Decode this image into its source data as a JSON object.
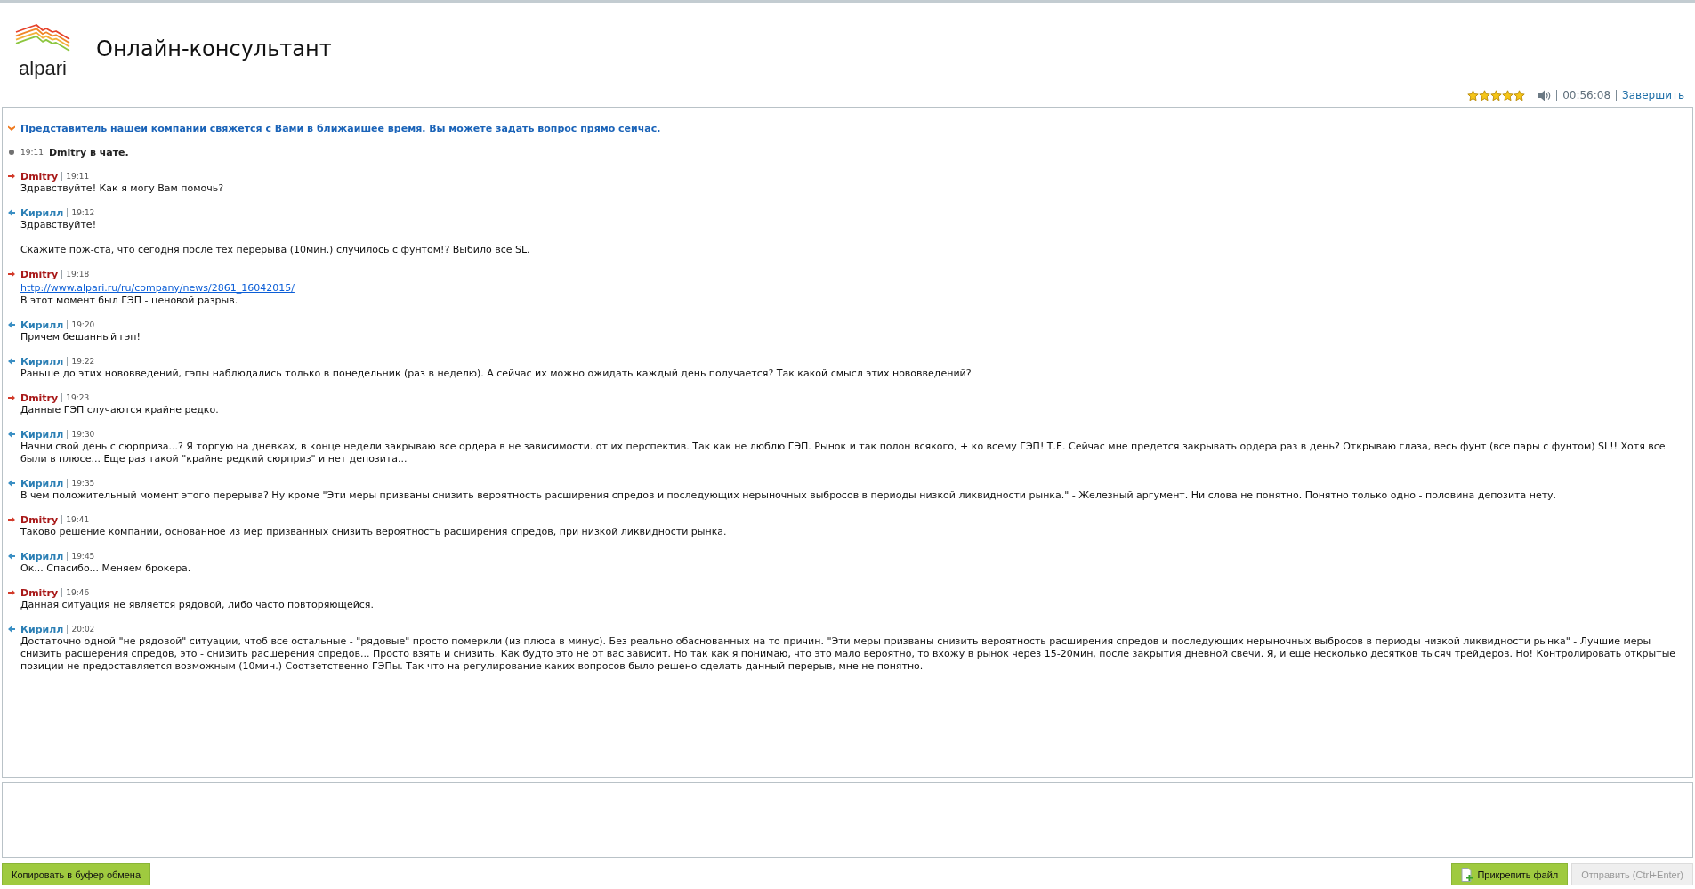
{
  "header": {
    "logo_text": "alpari",
    "title": "Онлайн-консультант"
  },
  "status": {
    "stars": 5,
    "timer": "00:56:08",
    "end_link": "Завершить"
  },
  "chat": {
    "items": [
      {
        "kind": "notice",
        "text": "Представитель нашей компании свяжется с Вами в ближайшее время. Вы можете задать вопрос прямо сейчас."
      },
      {
        "kind": "system",
        "time": "19:11",
        "text": "Dmitry в чате."
      },
      {
        "kind": "agent",
        "author": "Dmitry",
        "time": "19:11",
        "paragraphs": [
          {
            "lines": [
              {
                "kind": "text",
                "text": "Здравствуйте! Как я могу Вам помочь?"
              }
            ]
          }
        ]
      },
      {
        "kind": "client",
        "author": "Кирилл",
        "time": "19:12",
        "paragraphs": [
          {
            "lines": [
              {
                "kind": "text",
                "text": "Здравствуйте!"
              }
            ]
          },
          {
            "lines": [
              {
                "kind": "text",
                "text": "Скажите пож-ста, что сегодня после тех перерыва (10мин.) случилось с фунтом!? Выбило все SL."
              }
            ]
          }
        ]
      },
      {
        "kind": "agent",
        "author": "Dmitry",
        "time": "19:18",
        "paragraphs": [
          {
            "lines": [
              {
                "kind": "link",
                "text": "http://www.alpari.ru/ru/company/news/2861_16042015/"
              },
              {
                "kind": "text",
                "text": "В этот момент был ГЭП - ценовой разрыв."
              }
            ]
          }
        ]
      },
      {
        "kind": "client",
        "author": "Кирилл",
        "time": "19:20",
        "paragraphs": [
          {
            "lines": [
              {
                "kind": "text",
                "text": "Причем бешанный гэп!"
              }
            ]
          }
        ]
      },
      {
        "kind": "client",
        "author": "Кирилл",
        "time": "19:22",
        "paragraphs": [
          {
            "lines": [
              {
                "kind": "text",
                "text": "Раньше до этих нововведений, гэпы наблюдались только в понедельник (раз в неделю). А сейчас их можно ожидать каждый день получается? Так какой смысл этих нововведений?"
              }
            ]
          }
        ]
      },
      {
        "kind": "agent",
        "author": "Dmitry",
        "time": "19:23",
        "paragraphs": [
          {
            "lines": [
              {
                "kind": "text",
                "text": "Данные ГЭП случаются крайне редко."
              }
            ]
          }
        ]
      },
      {
        "kind": "client",
        "author": "Кирилл",
        "time": "19:30",
        "paragraphs": [
          {
            "lines": [
              {
                "kind": "text",
                "text": "Начни свой день с сюрприза...? Я торгую на дневках, в конце недели закрываю все ордера в не зависимости. от их перспектив. Так как не люблю ГЭП. Рынок и так полон всякого, + ко всему ГЭП! Т.Е. Сейчас мне предется закрывать ордера раз в день? Открываю глаза, весь фунт (все пары с фунтом) SL!! Хотя все были в плюсе... Еще раз такой \"крайне редкий сюрприз\" и нет депозита..."
              }
            ]
          }
        ]
      },
      {
        "kind": "client",
        "author": "Кирилл",
        "time": "19:35",
        "paragraphs": [
          {
            "lines": [
              {
                "kind": "text",
                "text": "В чем положительный момент этого перерыва? Ну кроме \"Эти меры призваны снизить вероятность расширения спредов и последующих нерыночных выбросов в периоды низкой ликвидности рынка.\" - Железный аргумент. Ни слова не понятно. Понятно только одно - половина депозита нету."
              }
            ]
          }
        ]
      },
      {
        "kind": "agent",
        "author": "Dmitry",
        "time": "19:41",
        "paragraphs": [
          {
            "lines": [
              {
                "kind": "text",
                "text": "Таково решение компании, основанное из мер призванных снизить вероятность расширения спредов, при низкой ликвидности рынка."
              }
            ]
          }
        ]
      },
      {
        "kind": "client",
        "author": "Кирилл",
        "time": "19:45",
        "paragraphs": [
          {
            "lines": [
              {
                "kind": "text",
                "text": "Ок... Спасибо... Меняем брокера."
              }
            ]
          }
        ]
      },
      {
        "kind": "agent",
        "author": "Dmitry",
        "time": "19:46",
        "paragraphs": [
          {
            "lines": [
              {
                "kind": "text",
                "text": "Данная ситуация не является рядовой, либо часто повторяющейся."
              }
            ]
          }
        ]
      },
      {
        "kind": "client",
        "author": "Кирилл",
        "time": "20:02",
        "paragraphs": [
          {
            "lines": [
              {
                "kind": "text",
                "text": "Достаточно одной \"не рядовой\" ситуации, чтоб все остальные - \"рядовые\" просто померкли (из плюса в минус). Без реально обаснованных на то причин. \"Эти меры призваны снизить вероятность расширения спредов и последующих нерыночных выбросов в периоды низкой ликвидности рынка\" - Лучшие меры снизить расшерения спредов, это - снизить расшерения спредов... Просто взять и снизить. Как будто это не от вас зависит. Но так как я понимаю, что это мало вероятно, то вхожу в рынок через 15-20мин, после закрытия дневной свечи. Я, и еще несколько десятков тысяч трейдеров. Но! Контролировать открытые позиции не предоставляется возможным (10мин.) Соответственно ГЭПы. Так что на регулирование каких вопросов было решено сделать данный перерыв, мне не понятно."
              }
            ]
          }
        ]
      }
    ]
  },
  "toolbar": {
    "left": [
      {
        "kind": "copy",
        "label": "Копировать в буфер обмена",
        "disabled": false
      }
    ],
    "right": [
      {
        "kind": "attach",
        "label": "Прикрепить файл",
        "disabled": false
      },
      {
        "kind": "send",
        "label": "Отправить (Ctrl+Enter)",
        "disabled": true
      }
    ]
  }
}
